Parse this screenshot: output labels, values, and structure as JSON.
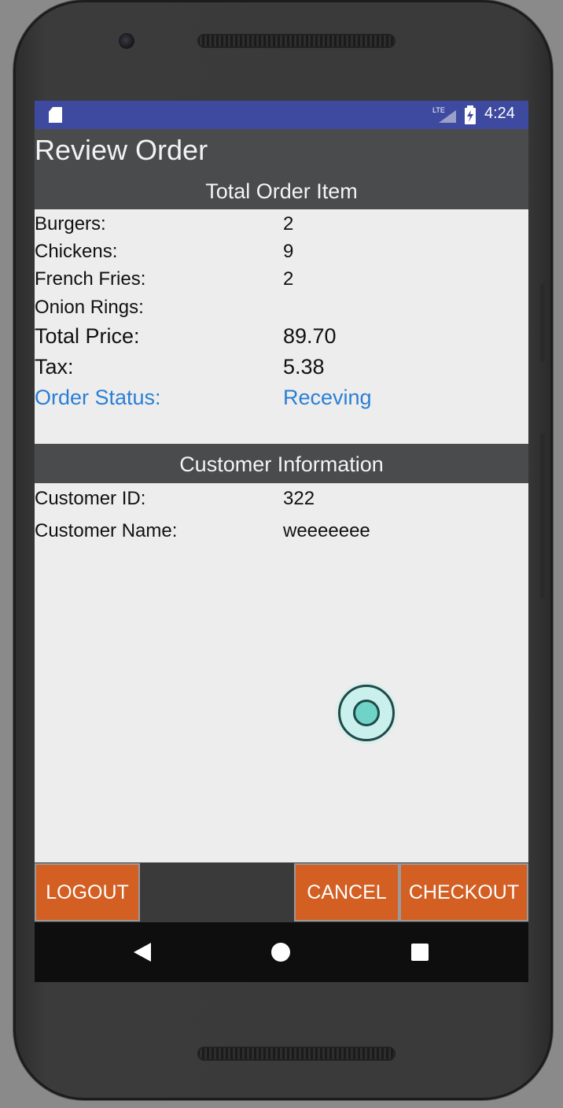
{
  "status_bar": {
    "time": "4:24",
    "network": "LTE",
    "icons": [
      "sd-card-icon",
      "lte-signal-icon",
      "battery-charging-icon"
    ]
  },
  "app_bar": {
    "title": "Review Order"
  },
  "order_section": {
    "header": "Total Order Item",
    "rows": [
      {
        "label": "Burgers:",
        "value": "2"
      },
      {
        "label": "Chickens:",
        "value": "9"
      },
      {
        "label": "French Fries:",
        "value": "2"
      },
      {
        "label": "Onion Rings:",
        "value": ""
      },
      {
        "label": "Total Price:",
        "value": "89.70"
      },
      {
        "label": "Tax:",
        "value": "5.38"
      },
      {
        "label": "Order Status:",
        "value": "Receving"
      }
    ]
  },
  "customer_section": {
    "header": "Customer Information",
    "rows": [
      {
        "label": "Customer ID:",
        "value": "322"
      },
      {
        "label": "Customer Name:",
        "value": "weeeeeee"
      }
    ]
  },
  "buttons": {
    "logout": "LOGOUT",
    "cancel": "CANCEL",
    "checkout": "CHECKOUT"
  },
  "nav_bar": {
    "icons": [
      "back-icon",
      "home-icon",
      "recents-icon"
    ]
  },
  "colors": {
    "status_bar": "#3e4aa0",
    "header_bg": "#4a4b4d",
    "content_bg": "#eeedee",
    "button_accent": "#d35f23",
    "status_text": "#2a7fd4"
  }
}
